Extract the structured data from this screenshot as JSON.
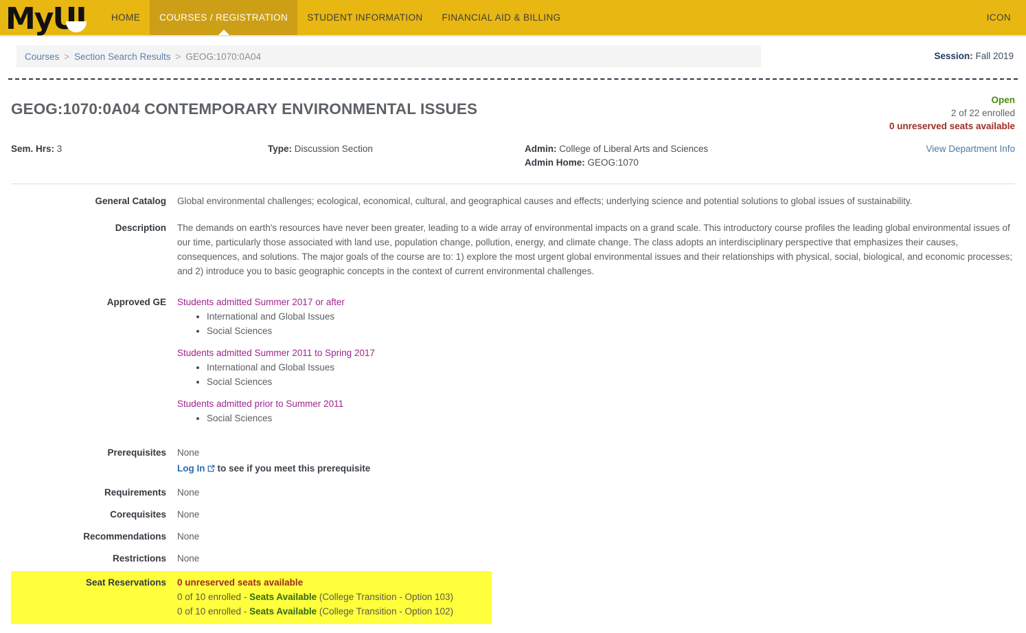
{
  "nav": {
    "logo": "MyUI",
    "items": [
      {
        "label": "HOME",
        "active": false
      },
      {
        "label": "COURSES / REGISTRATION",
        "active": true
      },
      {
        "label": "STUDENT INFORMATION",
        "active": false
      },
      {
        "label": "FINANCIAL AID & BILLING",
        "active": false
      }
    ],
    "right_label": "ICON"
  },
  "breadcrumb": {
    "courses": "Courses",
    "sep1": ">",
    "section_search": "Section Search Results",
    "sep2": ">",
    "current": "GEOG:1070:0A04"
  },
  "session": {
    "label": "Session:",
    "value": "Fall 2019"
  },
  "course": {
    "title": "GEOG:1070:0A04 CONTEMPORARY ENVIRONMENTAL ISSUES",
    "status": "Open",
    "enrolled": "2 of 22 enrolled",
    "unreserved": "0 unreserved seats available"
  },
  "meta": {
    "sem_hrs_label": "Sem. Hrs:",
    "sem_hrs_value": "3",
    "type_label": "Type:",
    "type_value": "Discussion Section",
    "admin_label": "Admin:",
    "admin_value": "College of Liberal Arts and Sciences",
    "admin_home_label": "Admin Home:",
    "admin_home_value": "GEOG:1070",
    "dept_link": "View Department Info"
  },
  "details": {
    "general_catalog_label": "General Catalog",
    "general_catalog_value": "Global environmental challenges; ecological, economical, cultural, and geographical causes and effects; underlying science and potential solutions to global issues of sustainability.",
    "description_label": "Description",
    "description_value": "The demands on earth's resources have never been greater, leading to a wide array of environmental impacts on a grand scale. This introductory course profiles the leading global environmental issues of our time, particularly those associated with land use, population change, pollution, energy, and climate change.  The class adopts an interdisciplinary perspective that emphasizes their causes, consequences, and solutions. The major goals of the course are to: 1) explore the most urgent global environmental issues and their relationships with physical, social, biological, and economic processes; and 2) introduce you to basic geographic concepts in the context of current environmental challenges.",
    "approved_ge_label": "Approved GE",
    "approved_ge_groups": [
      {
        "heading": "Students admitted Summer 2017 or after",
        "items": [
          "International and Global Issues",
          "Social Sciences"
        ]
      },
      {
        "heading": "Students admitted Summer 2011 to Spring 2017",
        "items": [
          "International and Global Issues",
          "Social Sciences"
        ]
      },
      {
        "heading": "Students admitted prior to Summer 2011",
        "items": [
          "Social Sciences"
        ]
      }
    ],
    "prerequisites_label": "Prerequisites",
    "prerequisites_value": "None",
    "login_link": "Log In",
    "login_suffix": "to see if you meet this prerequisite",
    "requirements_label": "Requirements",
    "requirements_value": "None",
    "corequisites_label": "Corequisites",
    "corequisites_value": "None",
    "recommendations_label": "Recommendations",
    "recommendations_value": "None",
    "restrictions_label": "Restrictions",
    "restrictions_value": "None"
  },
  "seat_reservations": {
    "label": "Seat Reservations",
    "headline": "0 unreserved seats available",
    "rows": [
      {
        "enrolled": "0 of 10 enrolled - ",
        "status": "Seats Available",
        "detail": " (College Transition - Option 103)"
      },
      {
        "enrolled": "0 of 10 enrolled - ",
        "status": "Seats Available",
        "detail": " (College Transition - Option 102)"
      }
    ]
  },
  "colors": {
    "brand_gold": "#e8b711",
    "active_tab": "#cc9f16",
    "open_green": "#4f8a10",
    "alert_red": "#9c2c22",
    "ge_magenta": "#a0248f",
    "link_blue": "#4a7ba7",
    "highlight_yellow": "#ffff3d"
  }
}
